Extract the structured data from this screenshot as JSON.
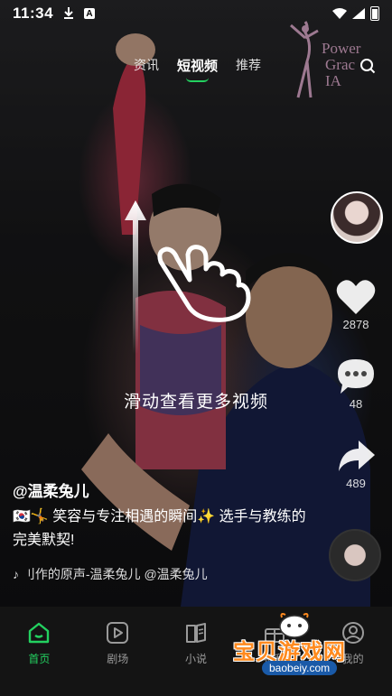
{
  "status_bar": {
    "time": "11:34",
    "download_icon": "download-icon",
    "app_icon": "A"
  },
  "top_tabs": [
    {
      "label": "资讯",
      "active": false
    },
    {
      "label": "短视频",
      "active": true
    },
    {
      "label": "推荐",
      "active": false
    }
  ],
  "video_logo": {
    "line1": "Power",
    "line2": "Grac",
    "line3": "IA"
  },
  "hint": {
    "text": "滑动查看更多视频"
  },
  "actions": {
    "like_count": "2878",
    "comment_count": "48",
    "share_count": "489"
  },
  "caption": {
    "author": "@温柔兔儿",
    "description": "🇰🇷🤸 笑容与专注相遇的瞬间✨ 选手与教练的完美默契!",
    "music": "♪ 刂作的原声-温柔兔儿    @温柔兔儿"
  },
  "bottom_nav": [
    {
      "label": "首页",
      "icon": "home-icon",
      "active": true
    },
    {
      "label": "剧场",
      "icon": "play-icon",
      "active": false
    },
    {
      "label": "小说",
      "icon": "book-icon",
      "active": false
    },
    {
      "label": "福利",
      "icon": "gift-icon",
      "active": false
    },
    {
      "label": "我的",
      "icon": "profile-icon",
      "active": false
    }
  ],
  "watermark": {
    "text": "宝贝游戏网",
    "url": "baobeiy.com"
  },
  "colors": {
    "accent": "#23d160",
    "nav_background": "#141414"
  }
}
